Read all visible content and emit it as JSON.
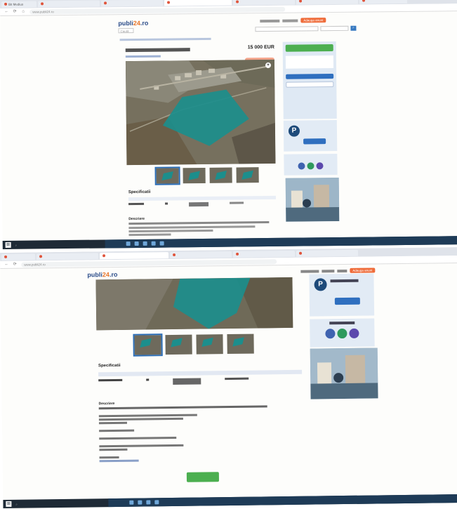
{
  "browser": {
    "tabs": [
      "Bit Medius",
      "",
      "",
      "",
      "",
      "",
      ""
    ],
    "url": "www.publi24.ro"
  },
  "header": {
    "logo_main": "publi",
    "logo_accent": "24",
    "logo_tld": ".ro",
    "add_ad_label": "Adauga anunt",
    "search_placeholder": "Caută"
  },
  "listing": {
    "price": "15 000 EUR",
    "thumb_count": 4
  },
  "sections": {
    "specs_title": "Specificatii",
    "description_title": "Descriere"
  },
  "specs": {
    "rows": [
      [
        "",
        "",
        "",
        "",
        ""
      ],
      [
        "",
        "",
        "",
        "",
        ""
      ]
    ]
  },
  "description": {
    "paragraphs": [
      "",
      "",
      "",
      "",
      "",
      "",
      ""
    ]
  },
  "sidebar": {
    "avatar_letter": "P",
    "phone_button": "",
    "message_button": ""
  },
  "colors": {
    "accent_orange": "#ef6c3a",
    "brand_blue": "#2c4d8a",
    "button_green": "#4caf50",
    "land_overlay": "#1c8e8c"
  },
  "icons": {
    "start": "windows-icon",
    "avatar": "profile-p-icon",
    "back": "back-arrow-icon",
    "refresh": "refresh-icon"
  }
}
